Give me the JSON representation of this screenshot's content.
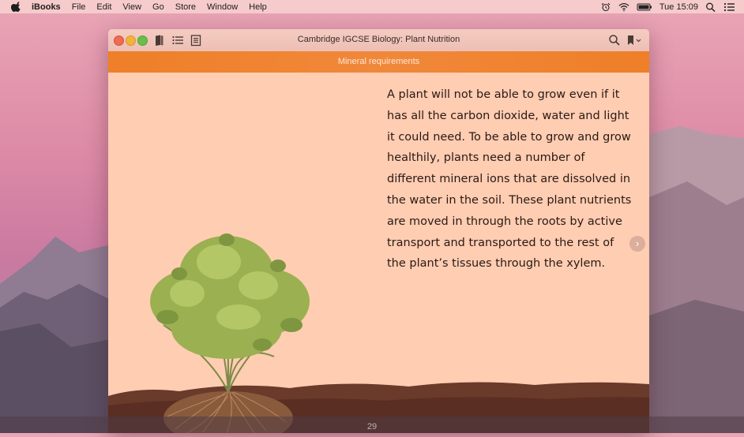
{
  "menubar": {
    "app_name": "iBooks",
    "items": [
      "File",
      "Edit",
      "View",
      "Go",
      "Store",
      "Window",
      "Help"
    ],
    "clock": "Tue 15:09"
  },
  "window": {
    "title": "Cambridge IGCSE Biology: Plant Nutrition",
    "section_header": "Mineral requirements",
    "body_text": "A plant will not be able to grow even if it has all the carbon dioxide, water and light it could need. To be able to grow and grow healthily, plants need a number of different mineral ions that are dissolved in the water in the soil. These plant nutrients are moved in through the roots by active transport and transported to the rest of the plant’s tissues through the xylem."
  },
  "page_number": "29",
  "colors": {
    "header_band": "#ef7f28",
    "page_bg": "#ffcdb2",
    "soil": "#6a3a2a"
  }
}
